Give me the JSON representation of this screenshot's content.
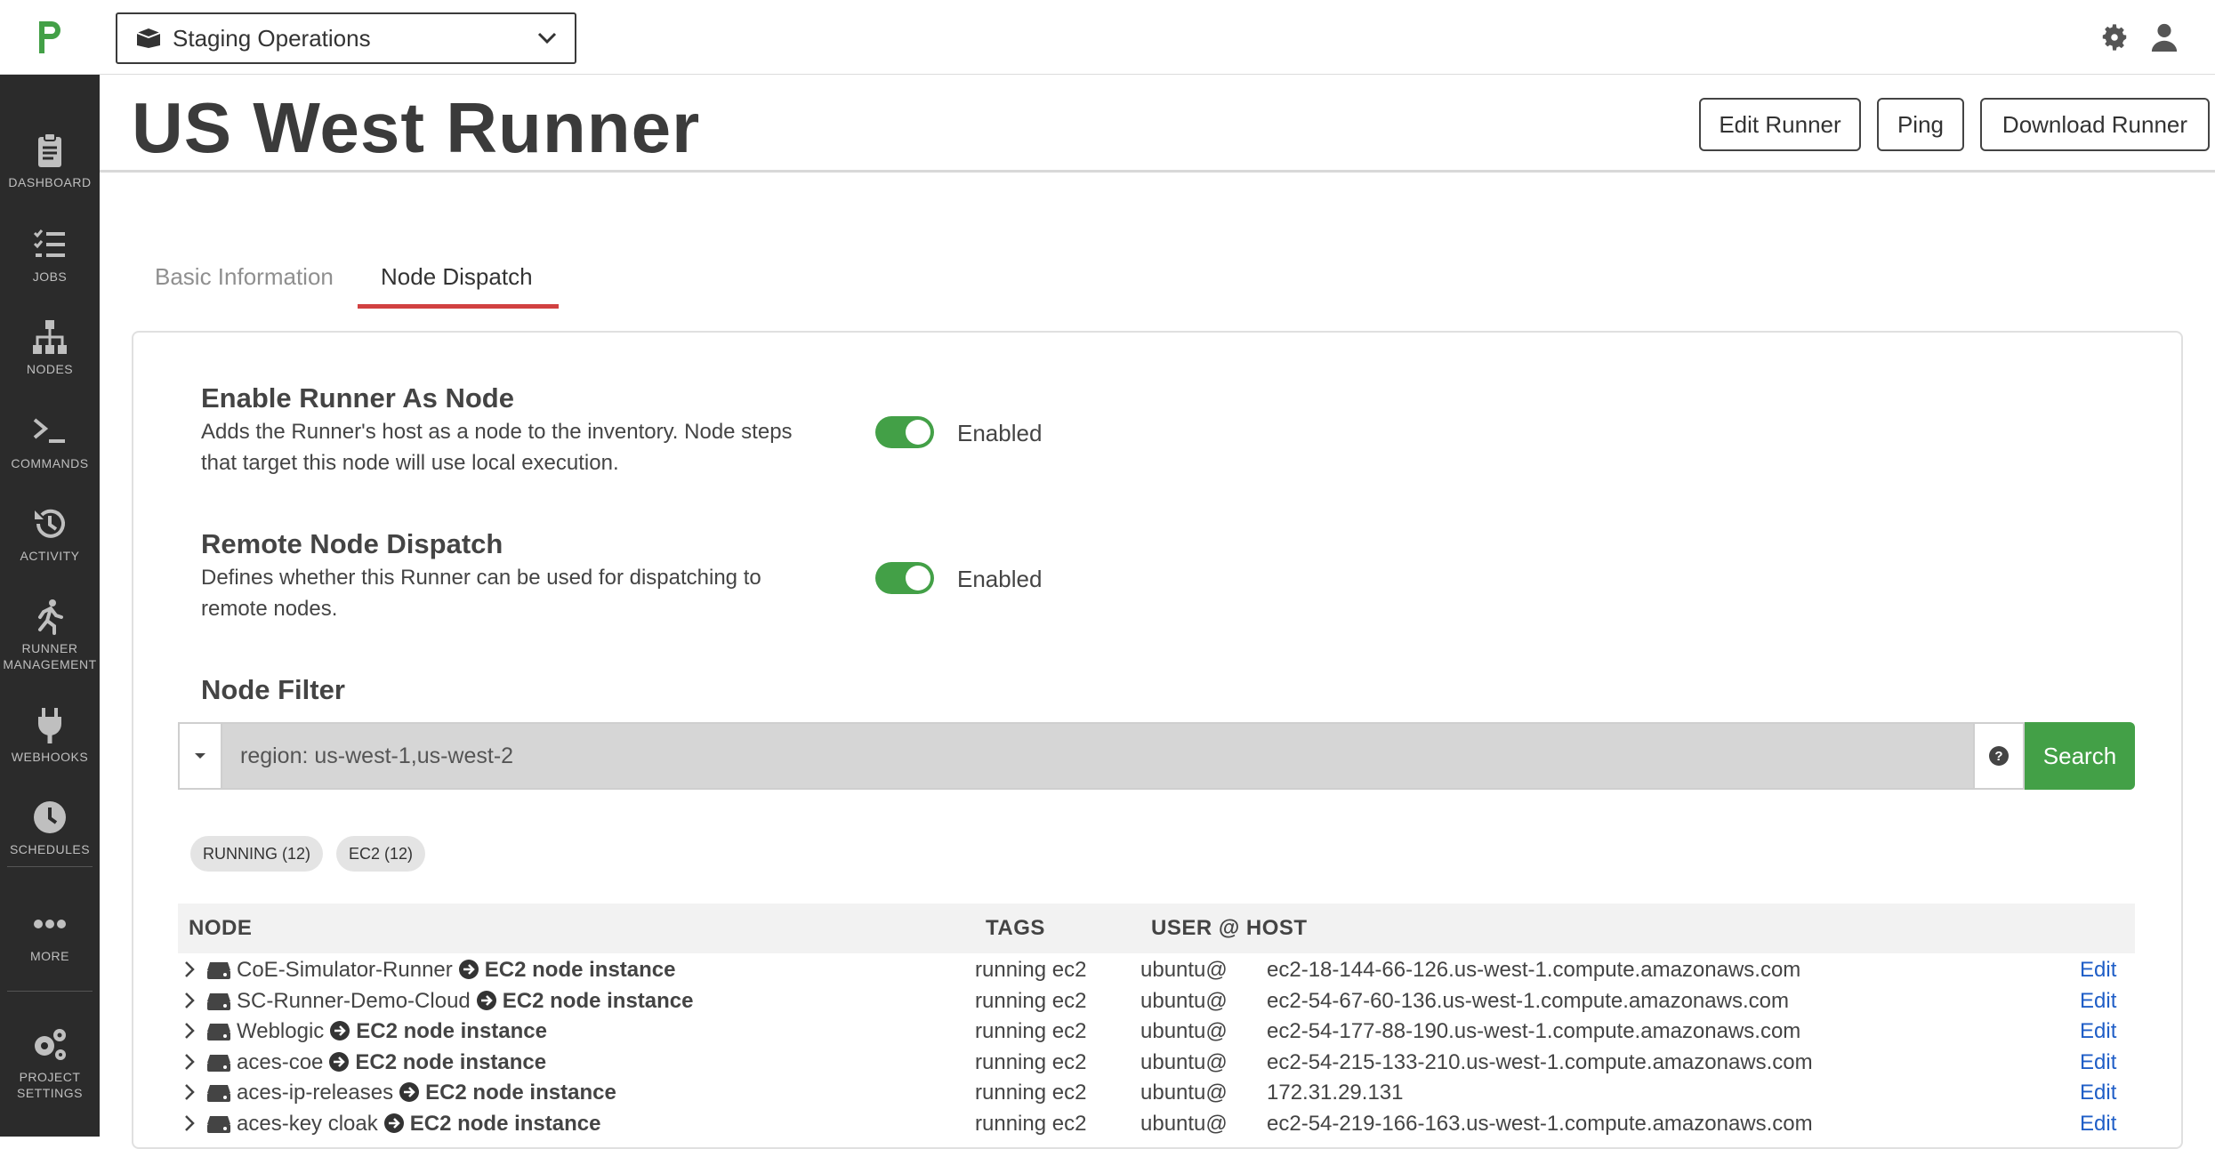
{
  "topbar": {
    "project": "Staging Operations"
  },
  "sidebar": {
    "items": [
      {
        "label": "DASHBOARD"
      },
      {
        "label": "JOBS"
      },
      {
        "label": "NODES"
      },
      {
        "label": "COMMANDS"
      },
      {
        "label": "ACTIVITY"
      },
      {
        "label": "RUNNER",
        "label2": "MANAGEMENT"
      },
      {
        "label": "WEBHOOKS"
      },
      {
        "label": "SCHEDULES"
      },
      {
        "label": "MORE"
      },
      {
        "label": "PROJECT",
        "label2": "SETTINGS"
      }
    ]
  },
  "header": {
    "title": "US West Runner",
    "buttons": {
      "edit": "Edit Runner",
      "ping": "Ping",
      "download": "Download Runner"
    }
  },
  "tabs": {
    "basic": "Basic Information",
    "node_dispatch": "Node Dispatch"
  },
  "settings": {
    "enable_node": {
      "title": "Enable Runner As Node",
      "desc": "Adds the Runner's host as a node to the inventory. Node steps that target this node will use local execution.",
      "state": "Enabled"
    },
    "remote_dispatch": {
      "title": "Remote Node Dispatch",
      "desc": "Defines whether this Runner can be used for dispatching to remote nodes.",
      "state": "Enabled"
    }
  },
  "filter": {
    "title": "Node Filter",
    "value": "region: us-west-1,us-west-2",
    "search_label": "Search"
  },
  "pills": [
    "RUNNING (12)",
    "EC2 (12)"
  ],
  "table": {
    "headers": {
      "node": "NODE",
      "tags": "TAGS",
      "userhost": "USER @ HOST"
    },
    "rows": [
      {
        "name": "CoE-Simulator-Runner",
        "desc": "EC2 node instance",
        "tags": "running ec2",
        "user": "ubuntu@",
        "host": "ec2-18-144-66-126.us-west-1.compute.amazonaws.com",
        "action": "Edit"
      },
      {
        "name": "SC-Runner-Demo-Cloud",
        "desc": "EC2 node instance",
        "tags": "running ec2",
        "user": "ubuntu@",
        "host": "ec2-54-67-60-136.us-west-1.compute.amazonaws.com",
        "action": "Edit"
      },
      {
        "name": "Weblogic",
        "desc": "EC2 node instance",
        "tags": "running ec2",
        "user": "ubuntu@",
        "host": "ec2-54-177-88-190.us-west-1.compute.amazonaws.com",
        "action": "Edit"
      },
      {
        "name": "aces-coe",
        "desc": "EC2 node instance",
        "tags": "running ec2",
        "user": "ubuntu@",
        "host": "ec2-54-215-133-210.us-west-1.compute.amazonaws.com",
        "action": "Edit"
      },
      {
        "name": "aces-ip-releases",
        "desc": "EC2 node instance",
        "tags": "running ec2",
        "user": "ubuntu@",
        "host": "172.31.29.131",
        "action": "Edit"
      },
      {
        "name": "aces-key cloak",
        "desc": "EC2 node instance",
        "tags": "running ec2",
        "user": "ubuntu@",
        "host": "ec2-54-219-166-163.us-west-1.compute.amazonaws.com",
        "action": "Edit"
      }
    ]
  },
  "colors": {
    "accent_green": "#43a047",
    "tab_red": "#d14141",
    "sidebar": "#2b2b2b",
    "link_blue": "#1f5ec7"
  }
}
